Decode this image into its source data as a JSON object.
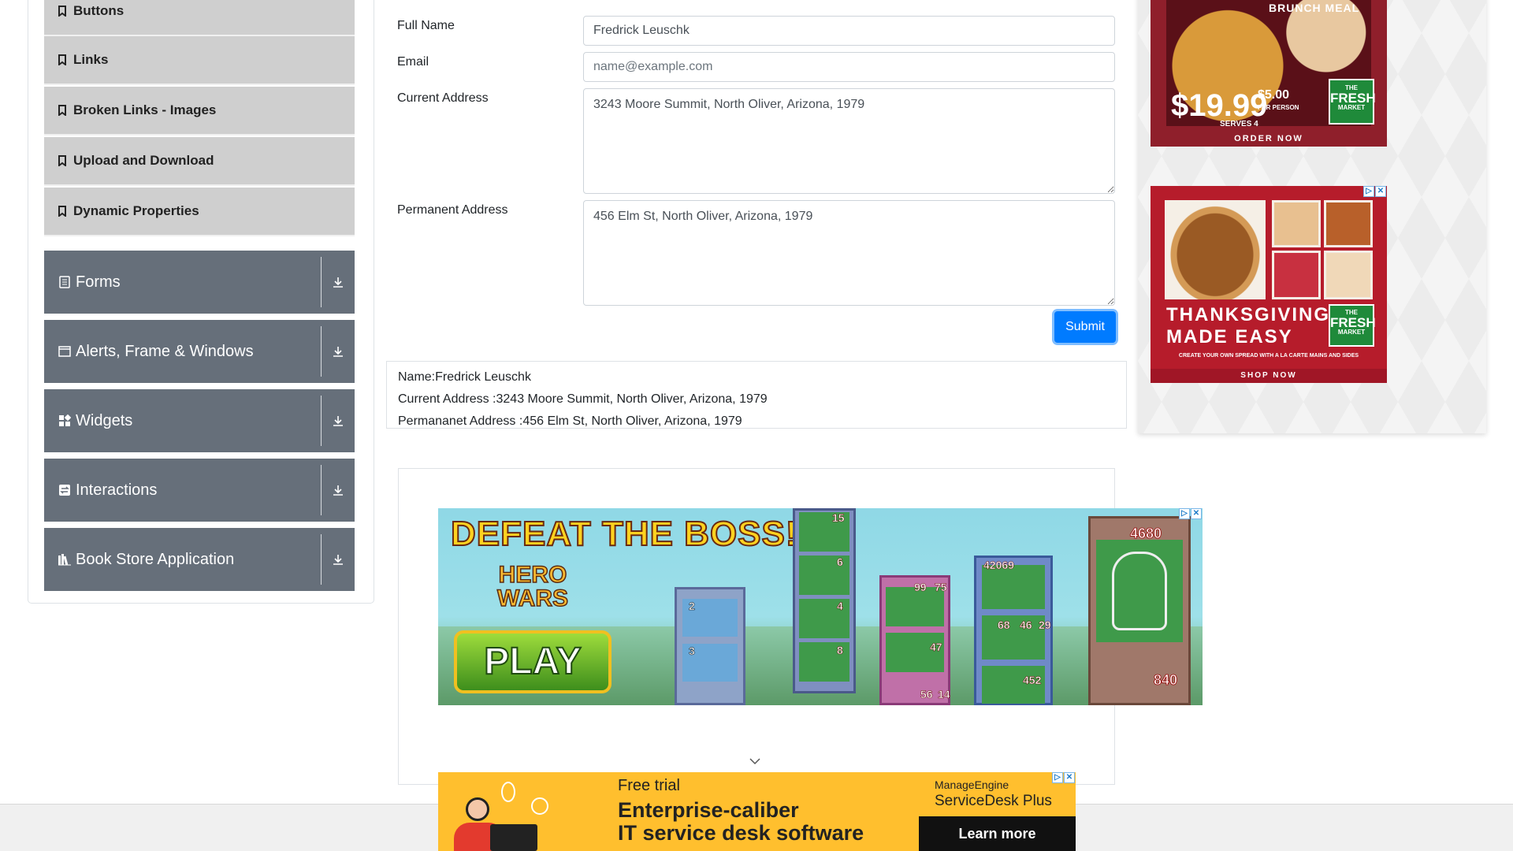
{
  "sidebar": {
    "elements_items": [
      {
        "label": "Buttons"
      },
      {
        "label": "Links"
      },
      {
        "label": "Broken Links - Images"
      },
      {
        "label": "Upload and Download"
      },
      {
        "label": "Dynamic Properties"
      }
    ],
    "groups": [
      {
        "label": "Forms",
        "icon": "document-icon"
      },
      {
        "label": "Alerts, Frame & Windows",
        "icon": "window-icon"
      },
      {
        "label": "Widgets",
        "icon": "widgets-icon"
      },
      {
        "label": "Interactions",
        "icon": "interactions-icon"
      },
      {
        "label": "Book Store Application",
        "icon": "books-icon"
      }
    ]
  },
  "form": {
    "full_name_label": "Full Name",
    "full_name_value": "Fredrick Leuschk",
    "email_label": "Email",
    "email_placeholder": "name@example.com",
    "current_address_label": "Current Address",
    "current_address_value": "3243 Moore Summit, North Oliver, Arizona, 1979",
    "permanent_address_label": "Permanent Address",
    "permanent_address_value": "456 Elm St, North Oliver, Arizona, 1979",
    "submit_label": "Submit"
  },
  "output": {
    "name": "Name:Fredrick Leuschk",
    "current_address": "Current Address :3243 Moore Summit, North Oliver, Arizona, 1979",
    "permanent_address": "Permananet Address :456 Elm St, North Oliver, Arizona, 1979"
  },
  "ads": {
    "brunch": {
      "heading": "BRUNCH MEAL",
      "price": "$19.99",
      "per_person_price": "$5.00",
      "per_person": "PER PERSON",
      "serves": "SERVES 4",
      "brand_the": "THE",
      "brand_fresh": "FRESH",
      "brand_market": "MARKET",
      "cta": "ORDER NOW"
    },
    "thanksgiving": {
      "line1": "THANKSGIVING",
      "line2": "MADE EASY",
      "brand_the": "THE",
      "brand_fresh": "FRESH",
      "brand_market": "MARKET",
      "subline": "CREATE YOUR OWN SPREAD WITH A LA CARTE MAINS AND SIDES",
      "cta": "SHOP NOW"
    },
    "game": {
      "headline": "DEFEAT THE BOSS!",
      "logo_line1": "HERO",
      "logo_line2": "WARS",
      "cta": "PLAY",
      "numbers": [
        "15",
        "6",
        "4",
        "8",
        "2",
        "3",
        "99",
        "75",
        "47",
        "56",
        "14",
        "42069",
        "68",
        "46",
        "29",
        "452",
        "4680",
        "840"
      ]
    },
    "servicedesk": {
      "free_trial": "Free trial",
      "brand_line1": "ManageEngine",
      "brand_line2": "ServiceDesk Plus",
      "headline1": "Enterprise-caliber",
      "headline2": "IT service desk software",
      "cta": "Learn more"
    }
  },
  "colors": {
    "accent": "#007bff",
    "sidebar_group": "#666f7a",
    "sidebar_item": "#cfcfcf"
  }
}
